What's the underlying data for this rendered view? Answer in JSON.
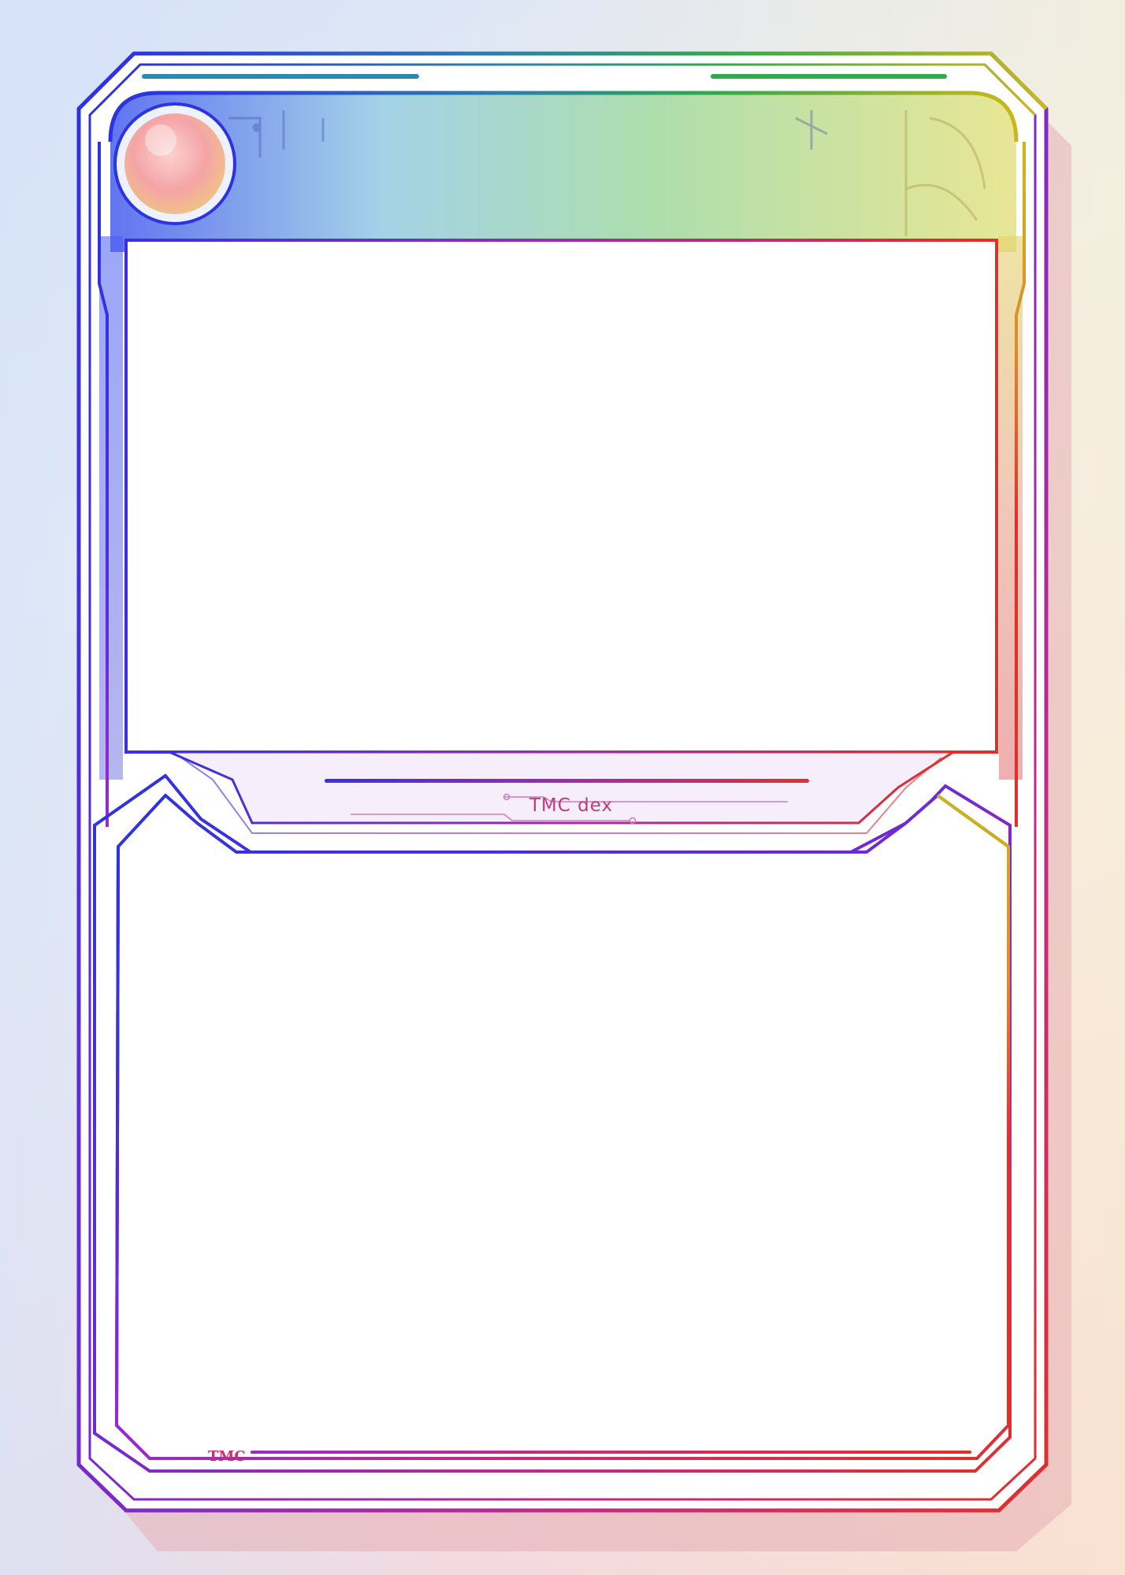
{
  "card": {
    "dex_label": "TMC dex",
    "brand_label": "TMC"
  },
  "icons": {
    "energy_orb": "energy-orb-icon"
  },
  "colors": {
    "blue": "#2a2fd8",
    "purple": "#8a2ad0",
    "red": "#e02a2a",
    "green": "#2faa4a",
    "yellow": "#c9c21a",
    "accent_text": "#c23a79",
    "orb": "#f6a7a8"
  }
}
